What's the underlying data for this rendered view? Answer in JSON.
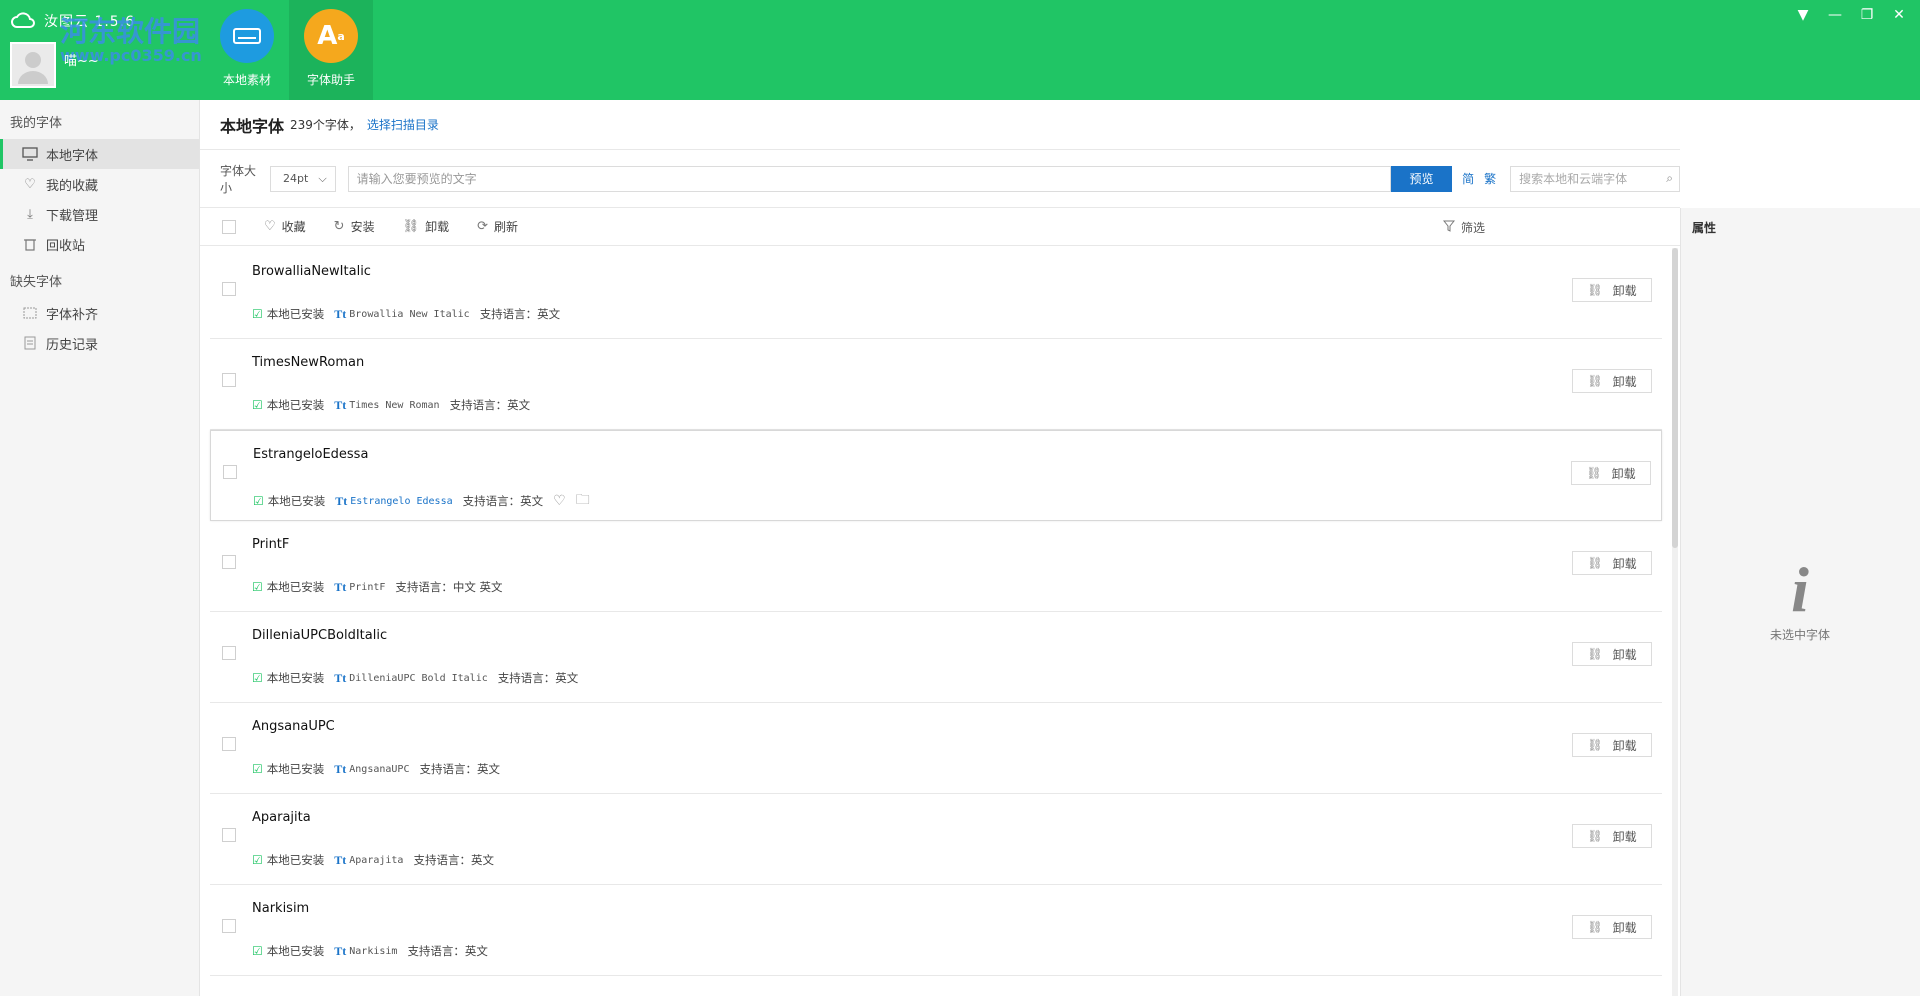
{
  "app": {
    "title": "汝图云 1.5.6",
    "user": "喵~~",
    "watermark": "河东软件园",
    "watermark_url": "www.pc0359.cn"
  },
  "top_nav": [
    {
      "label": "本地素材",
      "icon": "harddrive-icon",
      "color": "#1e9be0"
    },
    {
      "label": "字体助手",
      "icon": "font-assistant-icon",
      "color": "#f5a81d"
    }
  ],
  "sidebar": {
    "my_fonts_label": "我的字体",
    "my_fonts": [
      {
        "label": "本地字体",
        "icon": "monitor-icon",
        "active": true
      },
      {
        "label": "我的收藏",
        "icon": "heart-icon"
      },
      {
        "label": "下载管理",
        "icon": "download-icon"
      },
      {
        "label": "回收站",
        "icon": "trash-icon"
      }
    ],
    "missing_label": "缺失字体",
    "missing": [
      {
        "label": "字体补齐",
        "icon": "font-fill-icon"
      },
      {
        "label": "历史记录",
        "icon": "history-icon"
      }
    ]
  },
  "main": {
    "title": "本地字体",
    "count": "239个字体，",
    "scan_link": "选择扫描目录"
  },
  "preview": {
    "size_label": "字体大小",
    "size_value": "24pt",
    "input_placeholder": "请输入您要预览的文字",
    "preview_btn": "预览",
    "simplified": "简",
    "traditional": "繁",
    "search_placeholder": "搜索本地和云端字体"
  },
  "toolbar": {
    "favorite": "收藏",
    "install": "安装",
    "uninstall": "卸载",
    "refresh": "刷新",
    "filter": "筛选"
  },
  "fonts": [
    {
      "name": "BrowalliaNewItalic",
      "family": "Browallia New Italic",
      "languages": "支持语言：英文",
      "style": "italic",
      "size": 15
    },
    {
      "name": "TimesNewRoman",
      "family": "Times New Roman",
      "languages": "支持语言：英文",
      "style": "serif",
      "size": 22
    },
    {
      "name": "EstrangeloEdessa",
      "family": "Estrangelo Edessa",
      "languages": "支持语言：英文",
      "style": "serif",
      "size": 20
    },
    {
      "name": "PrintF",
      "family": "PrintF",
      "languages": "支持语言：中文 英文",
      "style": "print",
      "size": 22
    },
    {
      "name": "DilleniaUPCBoldItalic",
      "family": "DilleniaUPC Bold Italic",
      "languages": "支持语言：英文",
      "style": "bolditalic",
      "size": 13
    },
    {
      "name": "AngsanaUPC",
      "family": "AngsanaUPC",
      "languages": "支持语言：英文",
      "style": "serif",
      "size": 15
    },
    {
      "name": "Aparajita",
      "family": "Aparajita",
      "languages": "支持语言：英文",
      "style": "serif",
      "size": 17
    },
    {
      "name": "Narkisim",
      "family": "Narkisim",
      "languages": "支持语言：英文",
      "style": "sans",
      "size": 20
    }
  ],
  "font_row": {
    "installed": "本地已安装",
    "uninstall_btn": "卸载"
  },
  "props": {
    "title": "属性",
    "empty": "未选中字体"
  },
  "colors": {
    "header": "#20c565",
    "accent": "#1a73c8"
  }
}
